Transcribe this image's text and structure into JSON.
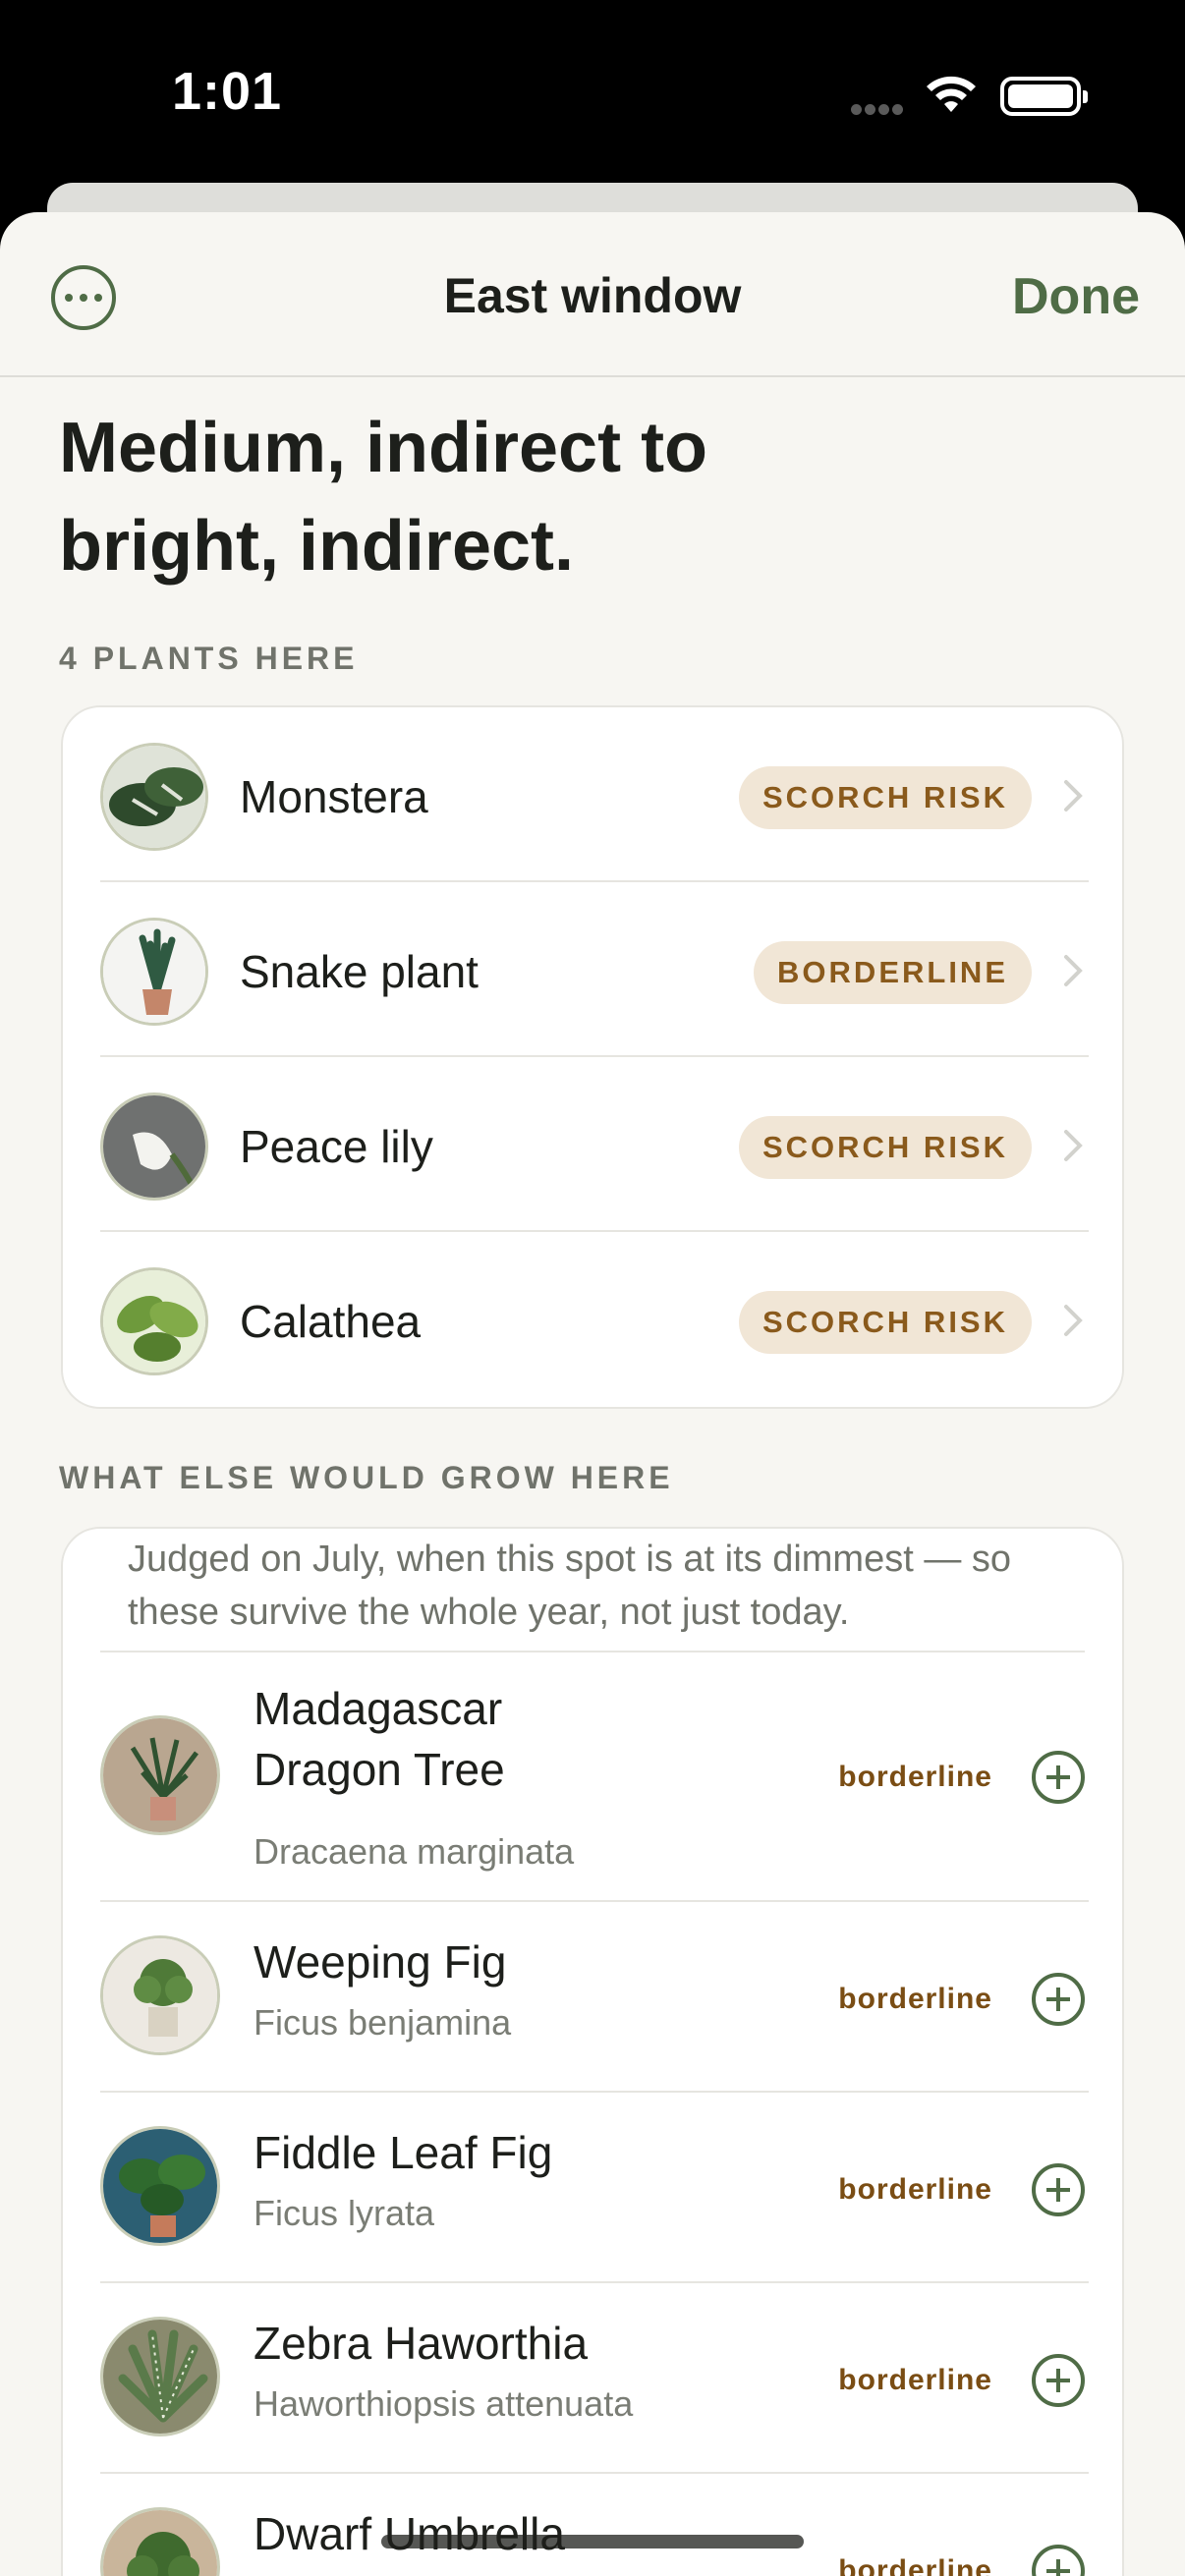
{
  "status_bar": {
    "time": "1:01"
  },
  "nav": {
    "title": "East window",
    "done_label": "Done"
  },
  "headline": "Medium, indirect to bright, indirect.",
  "plants_section": {
    "label": "4 PLANTS HERE",
    "items": [
      {
        "name": "Monstera",
        "badge": "SCORCH RISK"
      },
      {
        "name": "Snake plant",
        "badge": "BORDERLINE"
      },
      {
        "name": "Peace lily",
        "badge": "SCORCH RISK"
      },
      {
        "name": "Calathea",
        "badge": "SCORCH RISK"
      }
    ]
  },
  "suggest_section": {
    "label": "WHAT ELSE WOULD GROW HERE",
    "note": "Judged on July, when this spot is at its dimmest — so these survive the whole year, not just today.",
    "items": [
      {
        "common": "Madagascar Dragon Tree",
        "latin": "Dracaena marginata",
        "fit": "borderline"
      },
      {
        "common": "Weeping Fig",
        "latin": "Ficus benjamina",
        "fit": "borderline"
      },
      {
        "common": "Fiddle Leaf Fig",
        "latin": "Ficus lyrata",
        "fit": "borderline"
      },
      {
        "common": "Zebra Haworthia",
        "latin": "Haworthiopsis attenuata",
        "fit": "borderline"
      },
      {
        "common": "Dwarf Umbrella Tree",
        "latin": "",
        "fit": "borderline"
      }
    ]
  },
  "colors": {
    "accent": "#4f6c46",
    "badge_bg": "#f1e6d6",
    "badge_text": "#8a5a1c",
    "sheet_bg": "#f7f6f2"
  }
}
